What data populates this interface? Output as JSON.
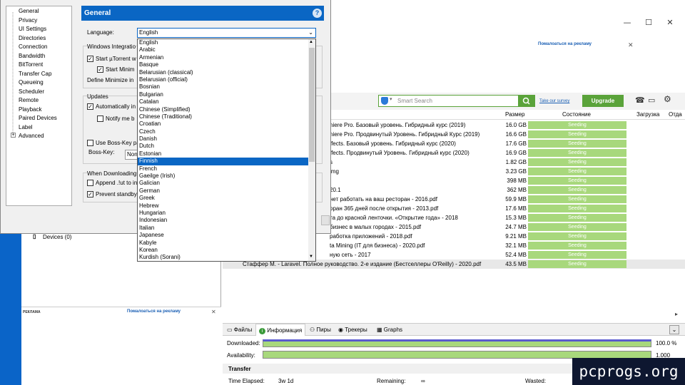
{
  "window": {
    "controls": {
      "minimize": "—",
      "maximize": "☐",
      "close": "✕"
    },
    "ad_text_top": "Помалоаться на рекламу",
    "ad_close": "✕",
    "ad_text_left": "Помалоаться на рекламу",
    "ad_left_label": "РЕКЛАМА"
  },
  "toolbar": {
    "search_placeholder": "Smart Search",
    "survey": "Take our survey",
    "upgrade": "Upgrade"
  },
  "table": {
    "headers": {
      "size": "Размер",
      "state": "Состояние",
      "upload": "Загрузка",
      "give": "Отда"
    },
    "rows": [
      {
        "name": "niere Pro. Базовый уровень. Гибридный курс (2019)",
        "size": "16.0 GB",
        "status": "Seeding"
      },
      {
        "name": "niere Pro. Продвинутый Уровень. Гибридный Курс (2019)",
        "size": "16.6 GB",
        "status": "Seeding"
      },
      {
        "name": "ffects. Базовый уровень. Гибридный курс (2020)",
        "size": "17.6 GB",
        "status": "Seeding"
      },
      {
        "name": "ffects. Продвинутый Уровень. Гибридный курс (2020)",
        "size": "16.9 GB",
        "status": "Seeding"
      },
      {
        "name": "s",
        "size": "1.82 GB",
        "status": "Seeding"
      },
      {
        "name": "lmg",
        "size": "3.23 GB",
        "status": "Seeding"
      },
      {
        "name": "",
        "size": "398 MB",
        "status": "Seeding"
      },
      {
        "name": "20.1",
        "size": "362 MB",
        "status": "Seeding"
      },
      {
        "name": "нет работать на ваш ресторан - 2016.pdf",
        "size": "59.9 MB",
        "status": "Seeding"
      },
      {
        "name": "оран 365 дней после открытия - 2013.pdf",
        "size": "17.6 MB",
        "status": "Seeding"
      },
      {
        "name": "та до красной ленточки. «Открытие года» - 2018",
        "size": "15.3 MB",
        "status": "Seeding"
      },
      {
        "name": "бизнес в малых городах - 2015.pdf",
        "size": "24.7 MB",
        "status": "Seeding"
      },
      {
        "name": "работка приложений - 2018.pdf",
        "size": "9.21 MB",
        "status": "Seeding"
      },
      {
        "name": "ta Mining (IT для бизнеса) - 2020.pdf",
        "size": "32.1 MB",
        "status": "Seeding"
      },
      {
        "name": "ную сеть - 2017",
        "size": "52.4 MB",
        "status": "Seeding"
      },
      {
        "name": "Стаффер М. - Laravel. Полное руководство. 2-е издание (Бестселлеры O'Reilly) - 2020.pdf",
        "size": "43.5 MB",
        "status": "Seeding"
      }
    ]
  },
  "left_panel": {
    "devices": "Devices (0)"
  },
  "details": {
    "tabs": [
      "Файлы",
      "Информация",
      "Пиры",
      "Трекеры",
      "Graphs"
    ],
    "downloaded_label": "Downloaded:",
    "downloaded_value": "100.0 %",
    "availability_label": "Availability:",
    "availability_value": "1.000",
    "transfer_title": "Transfer",
    "time_elapsed_label": "Time Elapsed:",
    "time_elapsed_value": "3w 1d",
    "remaining_label": "Remaining:",
    "remaining_value": "∞",
    "wasted_label": "Wasted:"
  },
  "dialog": {
    "tree": [
      "General",
      "Privacy",
      "UI Settings",
      "Directories",
      "Connection",
      "Bandwidth",
      "BitTorrent",
      "Transfer Cap",
      "Queueing",
      "Scheduler",
      "Remote",
      "Playback",
      "Paired Devices",
      "Label",
      "Advanced"
    ],
    "header": "General",
    "help": "?",
    "language_label": "Language:",
    "language_value": "English",
    "windows_integration": "Windows Integratio",
    "start_utorrent": "Start µTorrent w",
    "start_minimized": "Start Minim",
    "define_minimize": "Define Minimize in",
    "updates": "Updates",
    "auto_update": "Automatically in",
    "notify": "Notify me b",
    "boss_key_use": "Use Boss-Key pa",
    "boss_key_label": "Boss-Key:",
    "boss_key_value": "Non",
    "when_downloading": "When Downloading",
    "append": "Append .!ut to in",
    "prevent_standby": "Prevent standby",
    "languages": [
      "English",
      "Arabic",
      "Armenian",
      "Basque",
      "Belarusian (classical)",
      "Belarusian (official)",
      "Bosnian",
      "Bulgarian",
      "Catalan",
      "Chinese (Simplified)",
      "Chinese (Traditional)",
      "Croatian",
      "Czech",
      "Danish",
      "Dutch",
      "Estonian",
      "Finnish",
      "French",
      "Gaeilge (Irish)",
      "Galician",
      "German",
      "Greek",
      "Hebrew",
      "Hungarian",
      "Indonesian",
      "Italian",
      "Japanese",
      "Kabyle",
      "Korean",
      "Kurdish (Sorani)"
    ],
    "selected_language": "Finnish"
  },
  "watermark": "pcprogs.org"
}
